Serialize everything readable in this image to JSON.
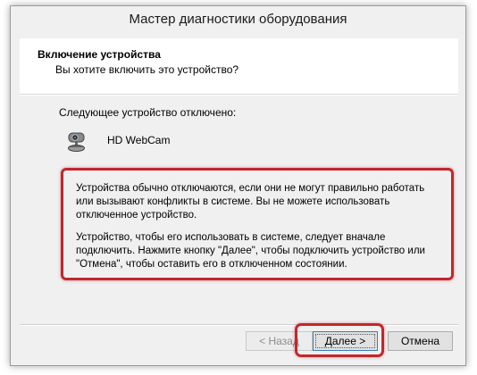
{
  "window": {
    "title": "Мастер диагностики оборудования"
  },
  "header": {
    "title": "Включение устройства",
    "subtitle": "Вы хотите включить это устройство?"
  },
  "content": {
    "status_text": "Следующее устройство отключено:",
    "device": {
      "name": "HD WebCam",
      "icon": "webcam-icon"
    },
    "info": {
      "paragraph1": "Устройства обычно отключаются, если они не могут правильно работать или вызывают конфликты в системе. Вы не можете использовать отключенное устройство.",
      "paragraph2": "Устройство, чтобы его использовать в системе, следует вначале подключить. Нажмите кнопку \"Далее\", чтобы подключить устройство или \"Отмена\", чтобы оставить его в отключенном состоянии."
    }
  },
  "buttons": {
    "back_label": "< Назад",
    "next_label": "Далее >",
    "cancel_label": "Отмена"
  },
  "colors": {
    "highlight": "#c1272d"
  }
}
